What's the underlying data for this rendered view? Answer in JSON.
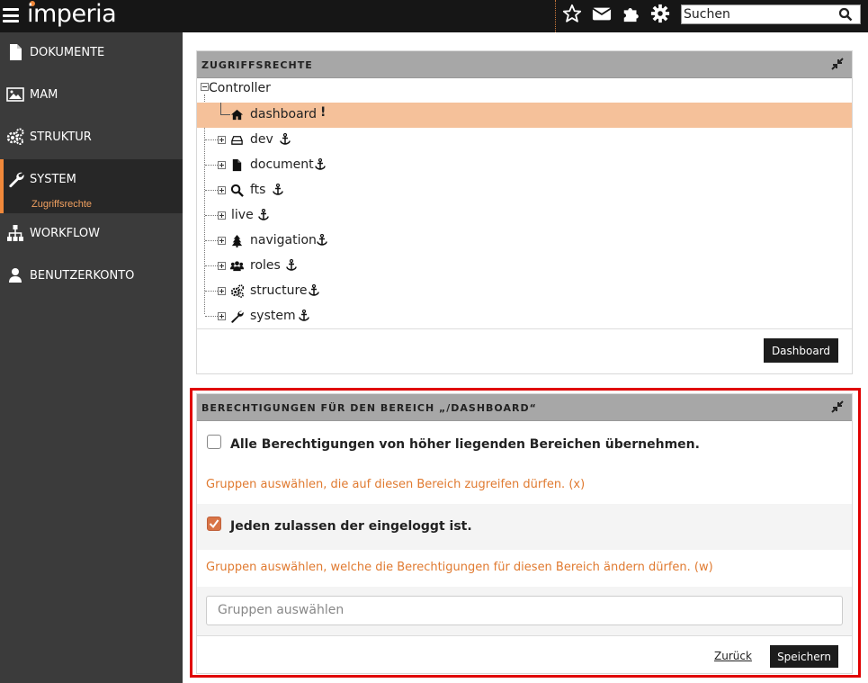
{
  "header": {
    "logo_text": "imperia",
    "search_placeholder": "Suchen",
    "icons": [
      "menu-icon",
      "star-icon",
      "mail-icon",
      "puzzle-icon",
      "gear-icon",
      "search-icon"
    ]
  },
  "sidebar": {
    "items": [
      {
        "label": "DOKUMENTE",
        "icon": "document-icon"
      },
      {
        "label": "MAM",
        "icon": "image-icon"
      },
      {
        "label": "STRUKTUR",
        "icon": "cogs-icon"
      },
      {
        "label": "SYSTEM",
        "icon": "wrench-icon",
        "active": true,
        "sub": "Zugriffsrechte"
      },
      {
        "label": "WORKFLOW",
        "icon": "sitemap-icon"
      },
      {
        "label": "BENUTZERKONTO",
        "icon": "user-icon"
      }
    ]
  },
  "access_panel": {
    "title": "ZUGRIFFSRECHTE",
    "root": "Controller",
    "nodes": [
      {
        "label": "dashboard",
        "icon": "home-icon",
        "selected": true,
        "marker": "!"
      },
      {
        "label": "dev",
        "icon": "drive-icon"
      },
      {
        "label": "document",
        "icon": "file-icon"
      },
      {
        "label": "fts",
        "icon": "search-icon"
      },
      {
        "label": "live",
        "icon": ""
      },
      {
        "label": "navigation",
        "icon": "tree-icon"
      },
      {
        "label": "roles",
        "icon": "users-icon"
      },
      {
        "label": "structure",
        "icon": "cogs-icon"
      },
      {
        "label": "system",
        "icon": "wrench-icon"
      }
    ],
    "button": "Dashboard"
  },
  "perm_panel": {
    "title": "BERECHTIGUNGEN FÜR DEN BEREICH „/DASHBOARD“",
    "inherit_label": "Alle Berechtigungen von höher liegenden Bereichen übernehmen.",
    "inherit_checked": false,
    "read_hint": "Gruppen auswählen, die auf diesen Bereich zugreifen dürfen. (x)",
    "everyone_label": "Jeden zulassen der eingeloggt ist.",
    "everyone_checked": true,
    "write_hint": "Gruppen auswählen, welche die Berechtigungen für diesen Bereich ändern dürfen. (w)",
    "group_placeholder": "Gruppen auswählen",
    "back_label": "Zurück",
    "save_label": "Speichern"
  },
  "colors": {
    "accent": "#f0883a",
    "selected_row": "#f5c19a",
    "highlight_frame": "#e00000",
    "hint": "#e07a30"
  }
}
